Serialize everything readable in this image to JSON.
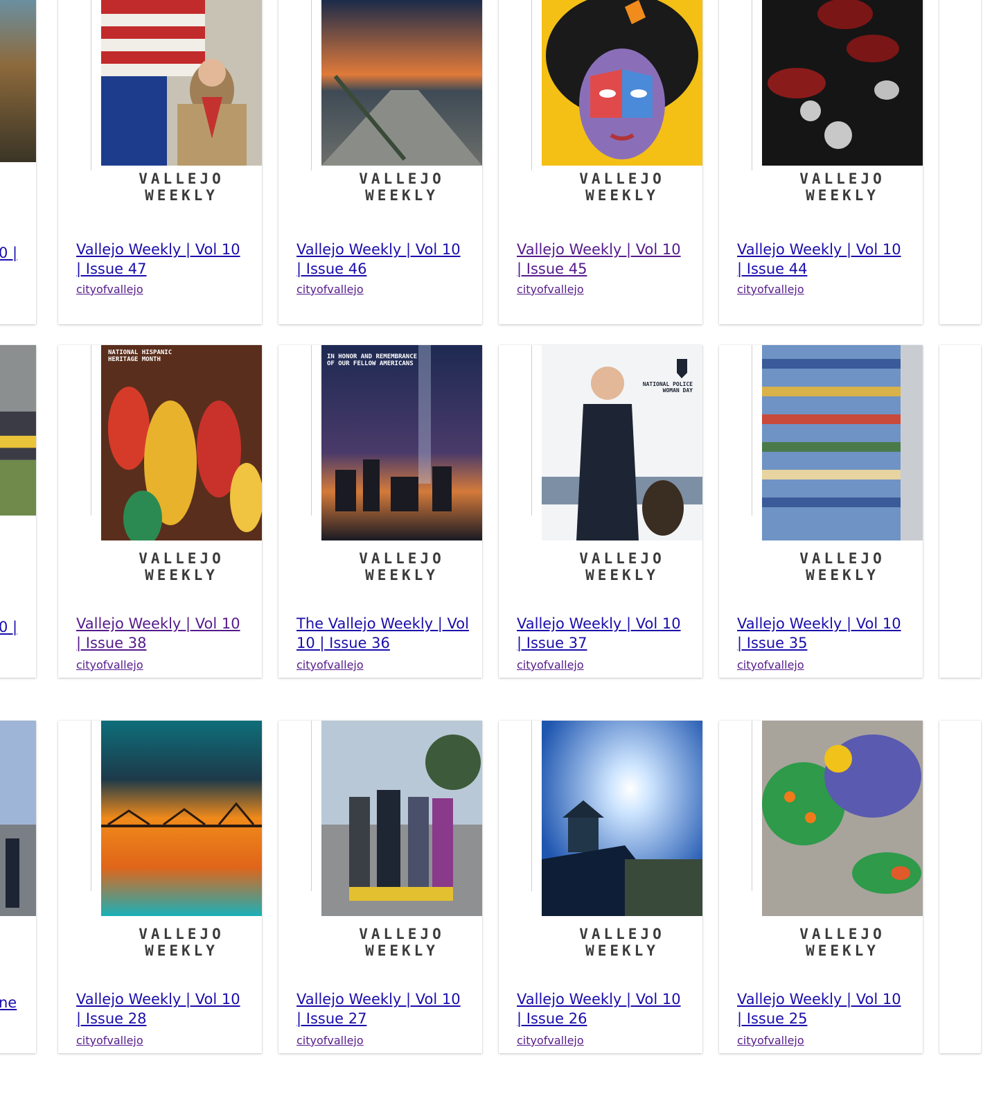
{
  "masthead": "VALLEJO WEEKLY",
  "author": "cityofvallejo",
  "rows": [
    {
      "left_fragment": "0 |",
      "cards": [
        {
          "title": "Vallejo Weekly | Vol 10 | Issue 47",
          "photo": "flag-scout",
          "visited": false
        },
        {
          "title": "Vallejo Weekly | Vol 10 | Issue 46",
          "photo": "sunset-ramp",
          "visited": false
        },
        {
          "title": "Vallejo Weekly | Vol 10 | Issue 45",
          "photo": "portrait-art",
          "visited": true
        },
        {
          "title": "Vallejo Weekly | Vol 10 | Issue 44",
          "photo": "firefighter-badges",
          "visited": false
        }
      ]
    },
    {
      "left_fragment": "0 |",
      "cards": [
        {
          "title": "Vallejo Weekly | Vol 10 | Issue 38",
          "photo": "hispanic-heritage-gourds",
          "visited": true,
          "cover_text": "NATIONAL HISPANIC HERITAGE MONTH"
        },
        {
          "title": "The Vallejo Weekly | Vol 10 | Issue 36",
          "photo": "city-skyline-911",
          "visited": false,
          "cover_text": "IN HONOR AND REMEMBRANCE OF OUR FELLOW AMERICANS"
        },
        {
          "title": "Vallejo Weekly | Vol 10 | Issue 37",
          "photo": "police-woman-dog",
          "visited": false,
          "cover_text": "NATIONAL POLICE WOMAN DAY"
        },
        {
          "title": "Vallejo Weekly | Vol 10 | Issue 35",
          "photo": "mosaic-stairs",
          "visited": false
        }
      ]
    },
    {
      "left_fragment": "ne",
      "cards": [
        {
          "title": "Vallejo Weekly | Vol 10 | Issue 28",
          "photo": "bridge-sunset",
          "visited": false
        },
        {
          "title": "Vallejo Weekly | Vol 10 | Issue 27",
          "photo": "group-photo",
          "visited": false
        },
        {
          "title": "Vallejo Weekly | Vol 10 | Issue 26",
          "photo": "clock-tower-sky",
          "visited": false
        },
        {
          "title": "Vallejo Weekly | Vol 10 | Issue 25",
          "photo": "fish-mural",
          "visited": false
        }
      ]
    }
  ],
  "colors": {
    "link": "#1a0dab",
    "visited": "#551a8b",
    "masthead": "#3b3b3b"
  }
}
